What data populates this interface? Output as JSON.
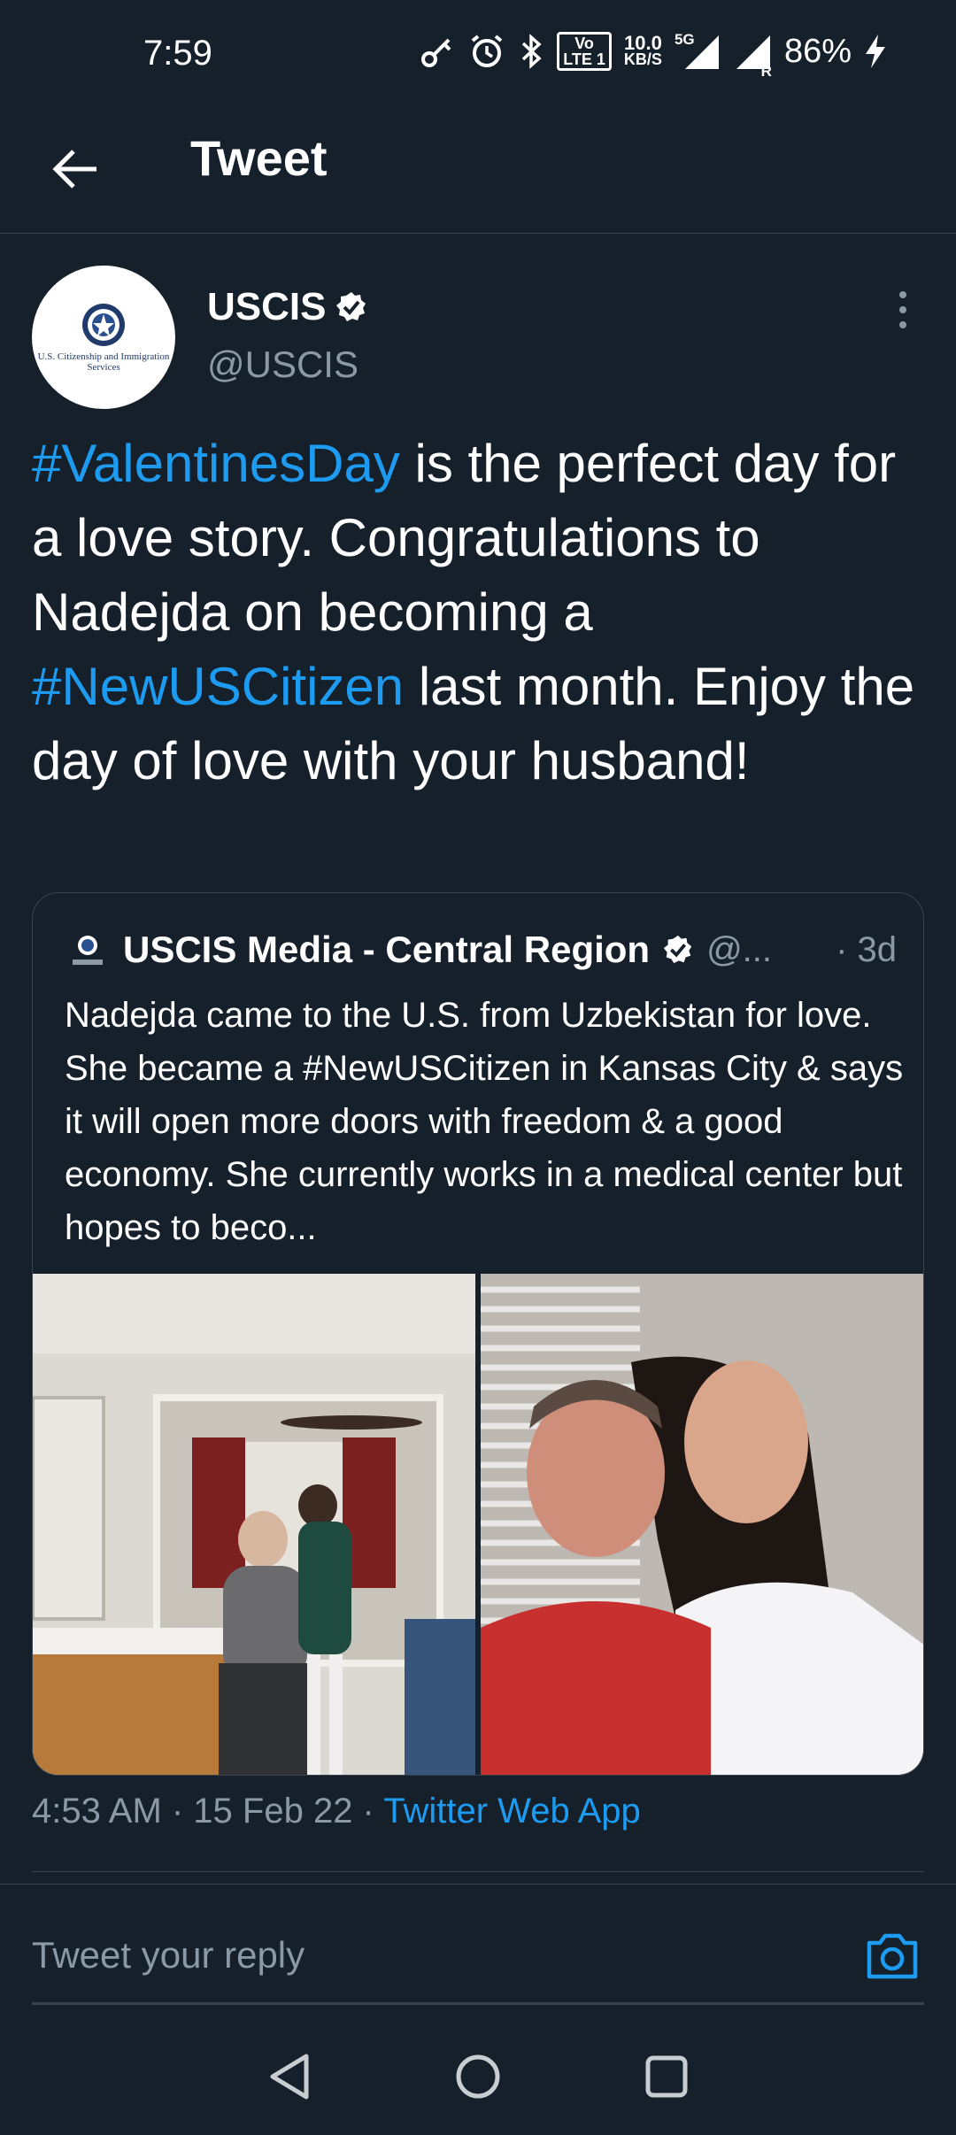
{
  "status_bar": {
    "time": "7:59",
    "network_speed": "10.0",
    "network_speed_unit": "KB/S",
    "volte_label_top": "Vo",
    "volte_label_bottom": "LTE 1",
    "network_type": "5G",
    "roaming_label": "R",
    "battery": "86%"
  },
  "header": {
    "title": "Tweet"
  },
  "tweet": {
    "author_name": "USCIS",
    "author_handle": "@USCIS",
    "avatar_caption": "U.S. Citizenship and Immigration Services",
    "body": {
      "hashtag1": "#ValentinesDay",
      "text1": " is the perfect day for a love story. Congratulations to Nadejda on becoming a ",
      "hashtag2": "#NewUSCitizen",
      "text2": " last month. Enjoy the day of love with your husband!"
    },
    "timestamp": "4:53 AM · 15 Feb 22 · ",
    "source": "Twitter Web App"
  },
  "quote": {
    "name": "USCIS Media - Central Region",
    "handle": "@...",
    "time": "· 3d",
    "text": "Nadejda came to the U.S. from Uzbekistan for love. She became a #NewUSCitizen in Kansas City & says it will open more doors with freedom & a good economy. She currently works in a medical center but hopes to beco..."
  },
  "reply": {
    "placeholder": "Tweet your reply"
  },
  "colors": {
    "background": "#15202b",
    "accent": "#1d9bf0",
    "secondary_text": "#8b98a5",
    "divider": "#38444d"
  },
  "icons": {
    "back": "arrow-left-icon",
    "verified": "verified-badge-icon",
    "more": "more-vertical-icon",
    "camera": "camera-icon",
    "nav_back": "triangle-back-icon",
    "nav_home": "circle-home-icon",
    "nav_recents": "square-recents-icon"
  }
}
